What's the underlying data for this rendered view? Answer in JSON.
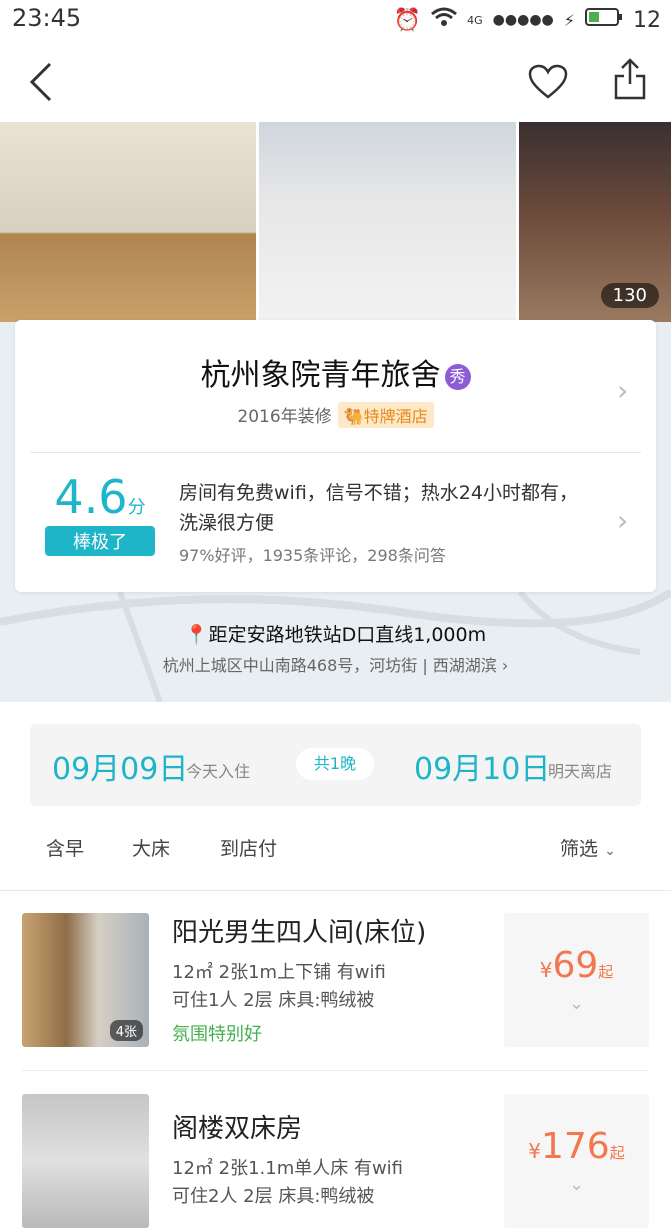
{
  "status": {
    "time": "23:45",
    "network": "4G",
    "battery": "12"
  },
  "photos": {
    "count": "130"
  },
  "hotel": {
    "name": "杭州象院青年旅舍",
    "badge": "秀",
    "renovation": "2016年装修",
    "tag": "特牌酒店",
    "score": "4.6",
    "score_unit": "分",
    "score_label": "棒极了",
    "review": "房间有免费wifi，信号不错；热水24小时都有，洗澡很方便",
    "review_stats": "97%好评，1935条评论，298条问答"
  },
  "location": {
    "distance": "距定安路地铁站D口直线1,000m",
    "address": "杭州上城区中山南路468号，河坊街 | 西湖湖滨"
  },
  "dates": {
    "checkin": "09月09日",
    "checkin_label": "今天入住",
    "nights": "共1晚",
    "checkout": "09月10日",
    "checkout_label": "明天离店"
  },
  "filters": {
    "items": [
      "含早",
      "大床",
      "到店付"
    ],
    "filter_label": "筛选"
  },
  "rooms": [
    {
      "title": "阳光男生四人间(床位)",
      "line1": "12㎡  2张1m上下铺  有wifi",
      "line2": "可住1人  2层  床具:鸭绒被",
      "highlight": "氛围特别好",
      "img_count": "4张",
      "currency": "¥",
      "price": "69",
      "price_suffix": "起"
    },
    {
      "title": "阁楼双床房",
      "line1": "12㎡  2张1.1m单人床  有wifi",
      "line2": "可住2人  2层  床具:鸭绒被",
      "currency": "¥",
      "price": "176",
      "price_suffix": "起"
    }
  ]
}
